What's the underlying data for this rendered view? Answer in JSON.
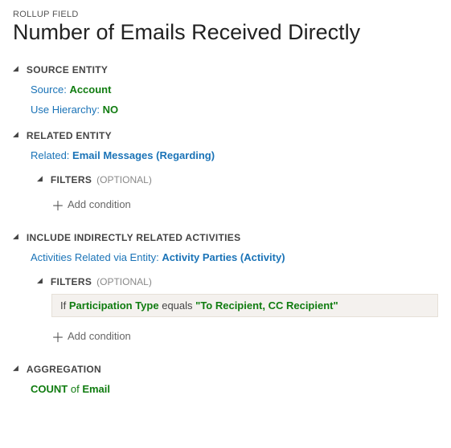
{
  "header": {
    "label": "ROLLUP FIELD",
    "title": "Number of Emails Received Directly"
  },
  "sections": {
    "source_entity": {
      "title": "SOURCE ENTITY",
      "source_label": "Source:",
      "source_value": "Account",
      "hierarchy_label": "Use Hierarchy:",
      "hierarchy_value": "NO"
    },
    "related_entity": {
      "title": "RELATED ENTITY",
      "related_label": "Related:",
      "related_value": "Email Messages",
      "related_paren": "Regarding",
      "filters_title": "FILTERS",
      "filters_optional": "(OPTIONAL)",
      "add_condition": "Add condition"
    },
    "indirect": {
      "title": "INCLUDE INDIRECTLY RELATED ACTIVITIES",
      "via_label": "Activities Related via Entity:",
      "via_value": "Activity Parties",
      "via_paren": "Activity",
      "filters_title": "FILTERS",
      "filters_optional": "(OPTIONAL)",
      "filter_if": "If",
      "filter_field": "Participation Type",
      "filter_op": "equals",
      "filter_value": "\"To Recipient, CC Recipient\"",
      "add_condition": "Add condition"
    },
    "aggregation": {
      "title": "AGGREGATION",
      "func": "COUNT",
      "of": "of",
      "target": "Email"
    }
  }
}
